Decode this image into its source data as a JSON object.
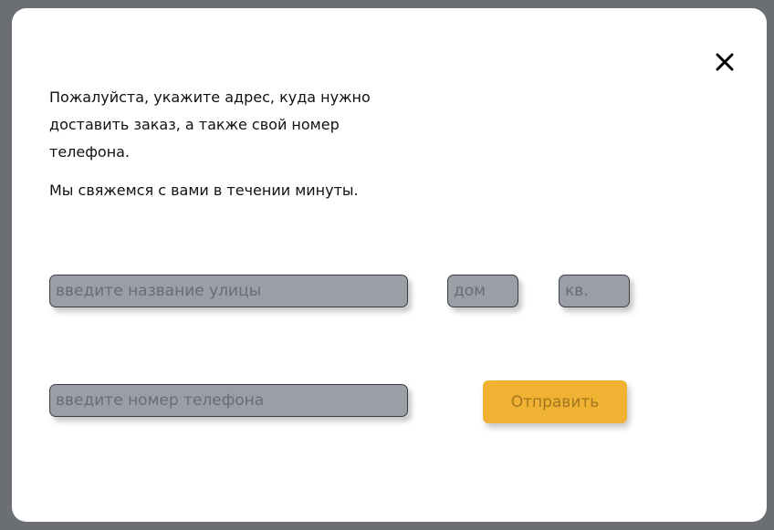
{
  "modal": {
    "close_icon": "close-icon",
    "message": {
      "line1": "Пожалуйста, укажите адрес, куда нужно доставить заказ, а также свой номер телефона.",
      "line2": "Мы свяжемся с вами в течении минуты."
    }
  },
  "form": {
    "street_placeholder": "введите название улицы",
    "house_placeholder": "дом",
    "apartment_placeholder": "кв.",
    "phone_placeholder": "введите номер телефона",
    "submit_label": "Отправить"
  },
  "colors": {
    "overlay": "#6b6e72",
    "modal_bg": "#ffffff",
    "field_bg": "#9a9fa6",
    "submit_bg": "#f0b232"
  }
}
